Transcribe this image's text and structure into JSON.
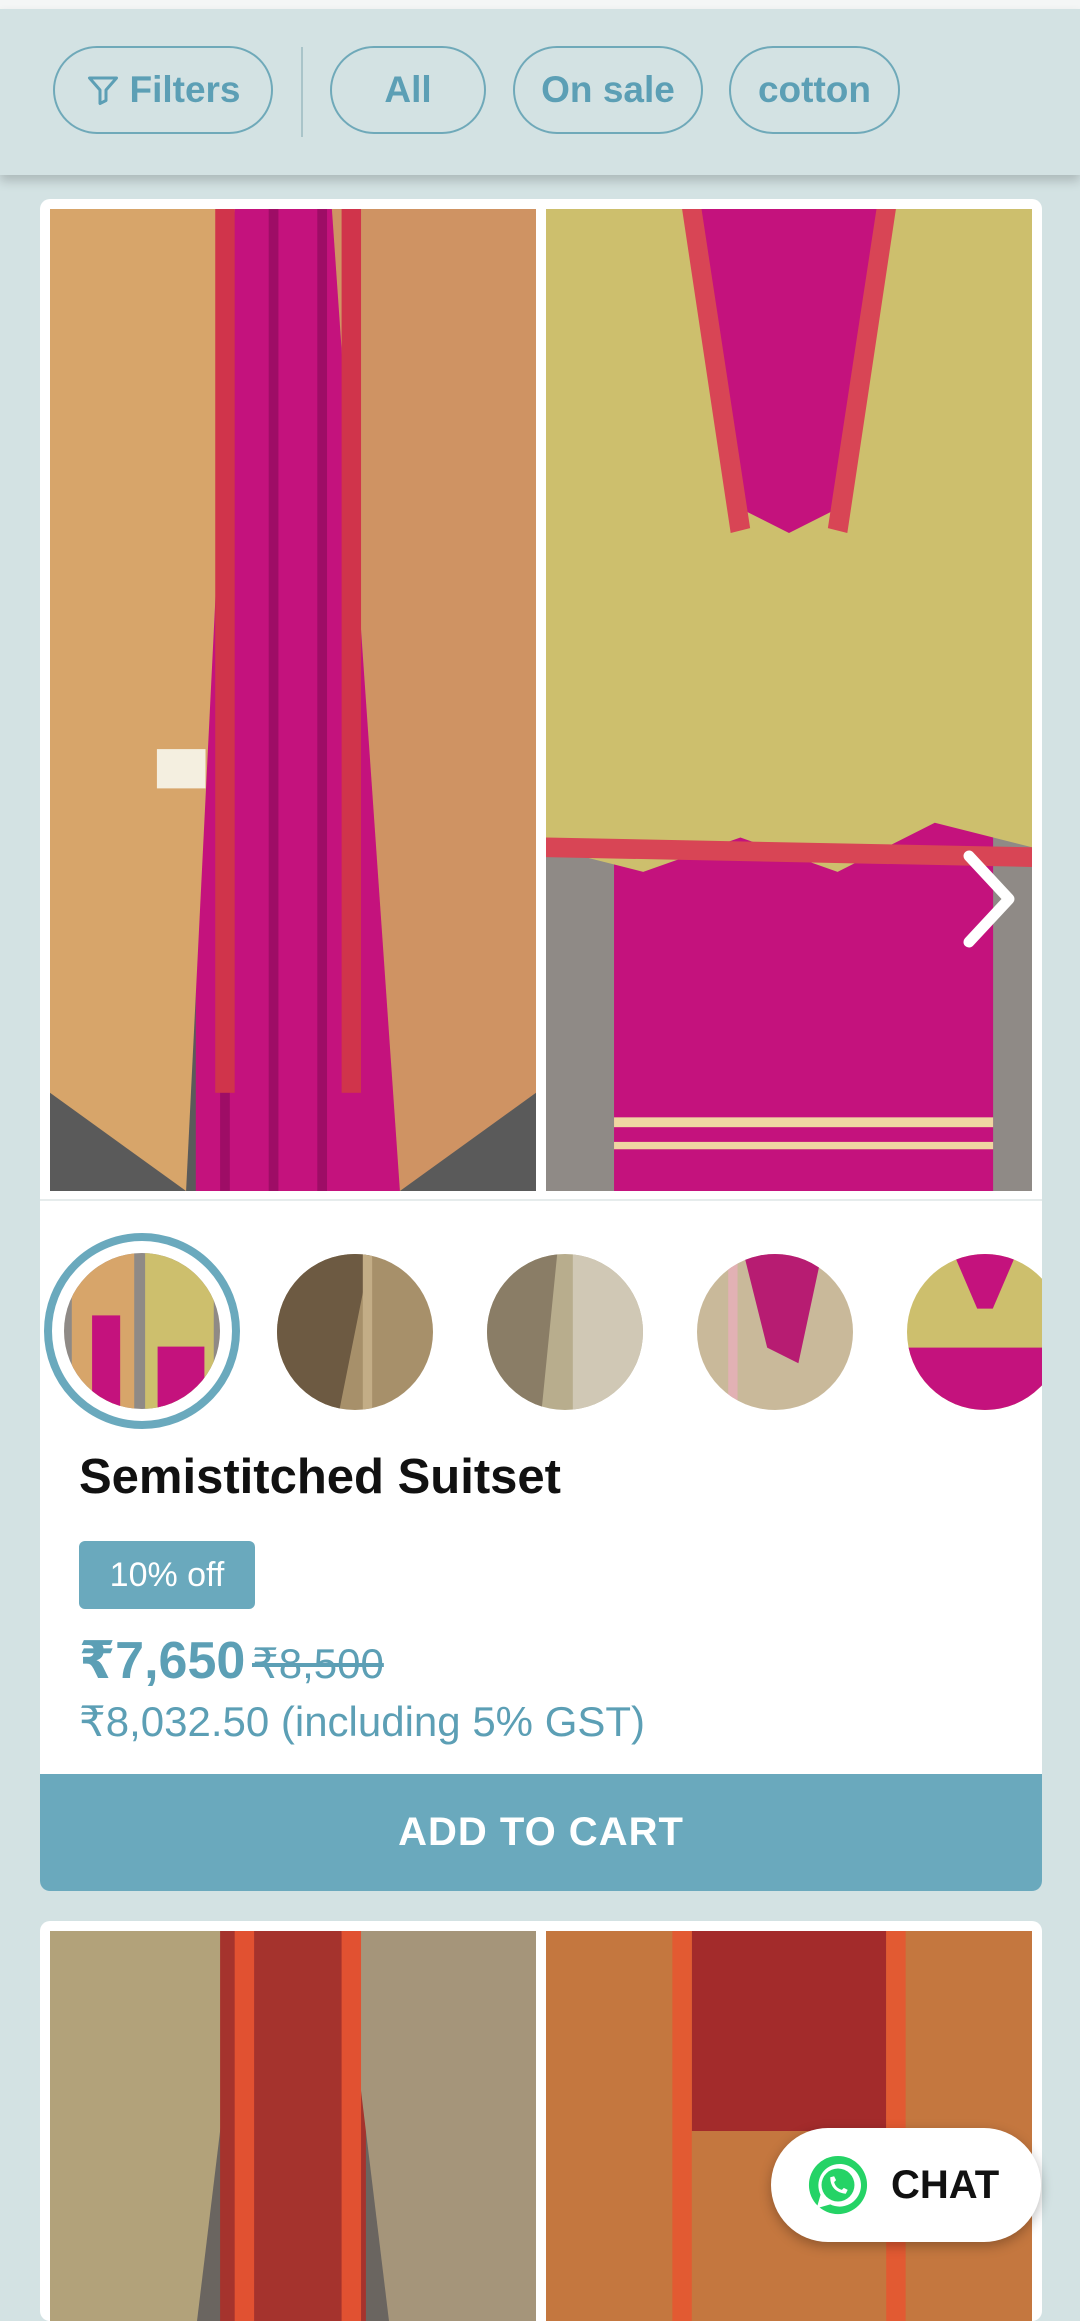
{
  "filters": {
    "filters_label": "Filters",
    "chips": [
      "All",
      "On sale",
      "cotton"
    ]
  },
  "product": {
    "title": "Semistitched Suitset",
    "discount_badge": "10% off",
    "price": "₹7,650",
    "mrp": "₹8,500",
    "gst_note": "₹8,032.50 (including 5% GST)",
    "add_to_cart": "ADD TO CART",
    "thumbnail_count": 5
  },
  "chat": {
    "label": "CHAT"
  },
  "colors": {
    "accent": "#6aa9bd",
    "background": "#d3e2e3",
    "price_text": "#5c9fb5",
    "whatsapp": "#25d366"
  },
  "icons": [
    "filter-icon",
    "chevron-right-icon",
    "whatsapp-icon"
  ]
}
